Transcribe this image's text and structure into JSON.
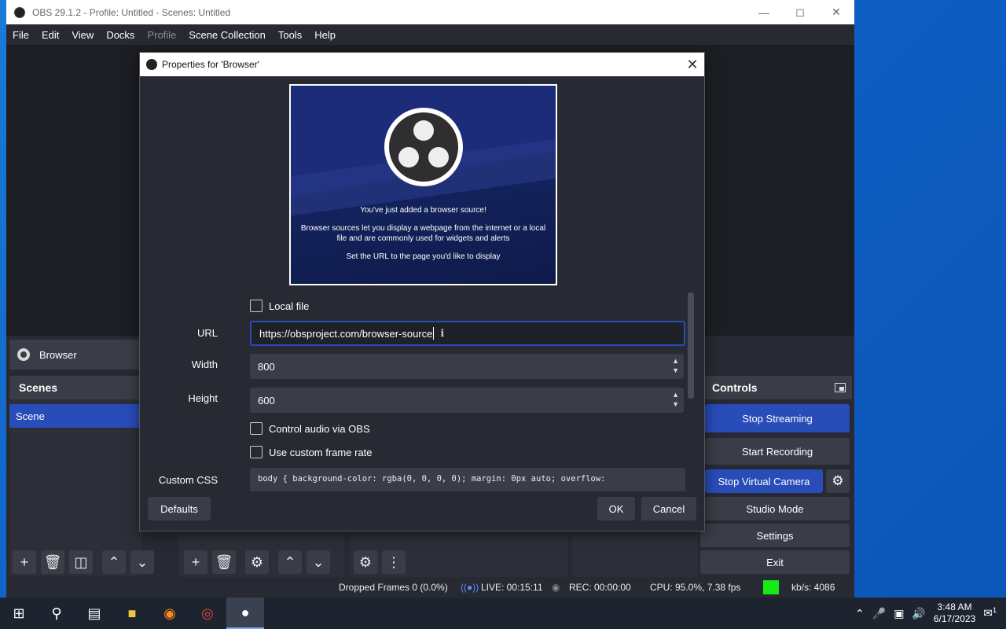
{
  "window": {
    "title": "OBS 29.1.2 - Profile: Untitled - Scenes: Untitled"
  },
  "menu": [
    "File",
    "Edit",
    "View",
    "Docks",
    "Profile",
    "Scene Collection",
    "Tools",
    "Help"
  ],
  "source": {
    "name": "Browser"
  },
  "scenes": {
    "title": "Scenes",
    "items": [
      "Scene"
    ]
  },
  "controls": {
    "title": "Controls",
    "stop_streaming": "Stop Streaming",
    "start_recording": "Start Recording",
    "stop_virtual_camera": "Stop Virtual Camera",
    "studio_mode": "Studio Mode",
    "settings": "Settings",
    "exit": "Exit"
  },
  "dialog": {
    "title": "Properties for 'Browser'",
    "preview": {
      "line1": "You've just added a browser source!",
      "line2": "Browser sources let you display a webpage from the internet or a local file and are commonly used for widgets and alerts",
      "line3": "Set the URL to the page you'd like to display"
    },
    "local_file_label": "Local file",
    "url_label": "URL",
    "url_value": "https://obsproject.com/browser-source",
    "width_label": "Width",
    "width_value": "800",
    "height_label": "Height",
    "height_value": "600",
    "control_audio_label": "Control audio via OBS",
    "custom_frame_rate_label": "Use custom frame rate",
    "custom_css_label": "Custom CSS",
    "custom_css_value": "body { background-color: rgba(0, 0, 0, 0); margin: 0px auto; overflow:",
    "defaults_button": "Defaults",
    "ok_button": "OK",
    "cancel_button": "Cancel"
  },
  "status": {
    "dropped_frames": "Dropped Frames 0 (0.0%)",
    "live": "LIVE: 00:15:11",
    "rec": "REC: 00:00:00",
    "cpu": "CPU: 95.0%, 7.38 fps",
    "kbs": "kb/s: 4086"
  },
  "taskbar": {
    "time": "3:48 AM",
    "date": "6/17/2023",
    "notifications": "1"
  },
  "colors": {
    "accent": "#284cb8",
    "bitrate_indicator": "#16ea16"
  }
}
